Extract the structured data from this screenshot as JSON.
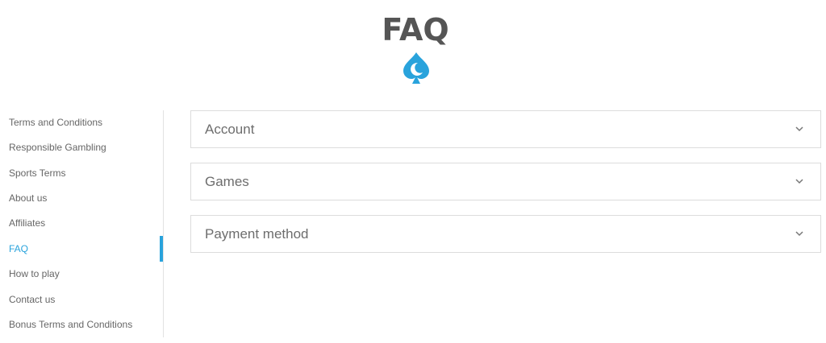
{
  "header": {
    "title": "FAQ",
    "logo_icon": "spade-moon-icon",
    "brand_color": "#29a3dc"
  },
  "sidebar": {
    "items": [
      {
        "label": "Terms and Conditions",
        "active": false
      },
      {
        "label": "Responsible Gambling",
        "active": false
      },
      {
        "label": "Sports Terms",
        "active": false
      },
      {
        "label": "About us",
        "active": false
      },
      {
        "label": "Affiliates",
        "active": false
      },
      {
        "label": "FAQ",
        "active": true
      },
      {
        "label": "How to play",
        "active": false
      },
      {
        "label": "Contact us",
        "active": false
      },
      {
        "label": "Bonus Terms and Conditions",
        "active": false
      }
    ],
    "active_color": "#29a3dc"
  },
  "faq": {
    "sections": [
      {
        "label": "Account",
        "icon": "chevron-down-icon"
      },
      {
        "label": "Games",
        "icon": "chevron-down-icon"
      },
      {
        "label": "Payment method",
        "icon": "chevron-down-icon"
      }
    ]
  }
}
